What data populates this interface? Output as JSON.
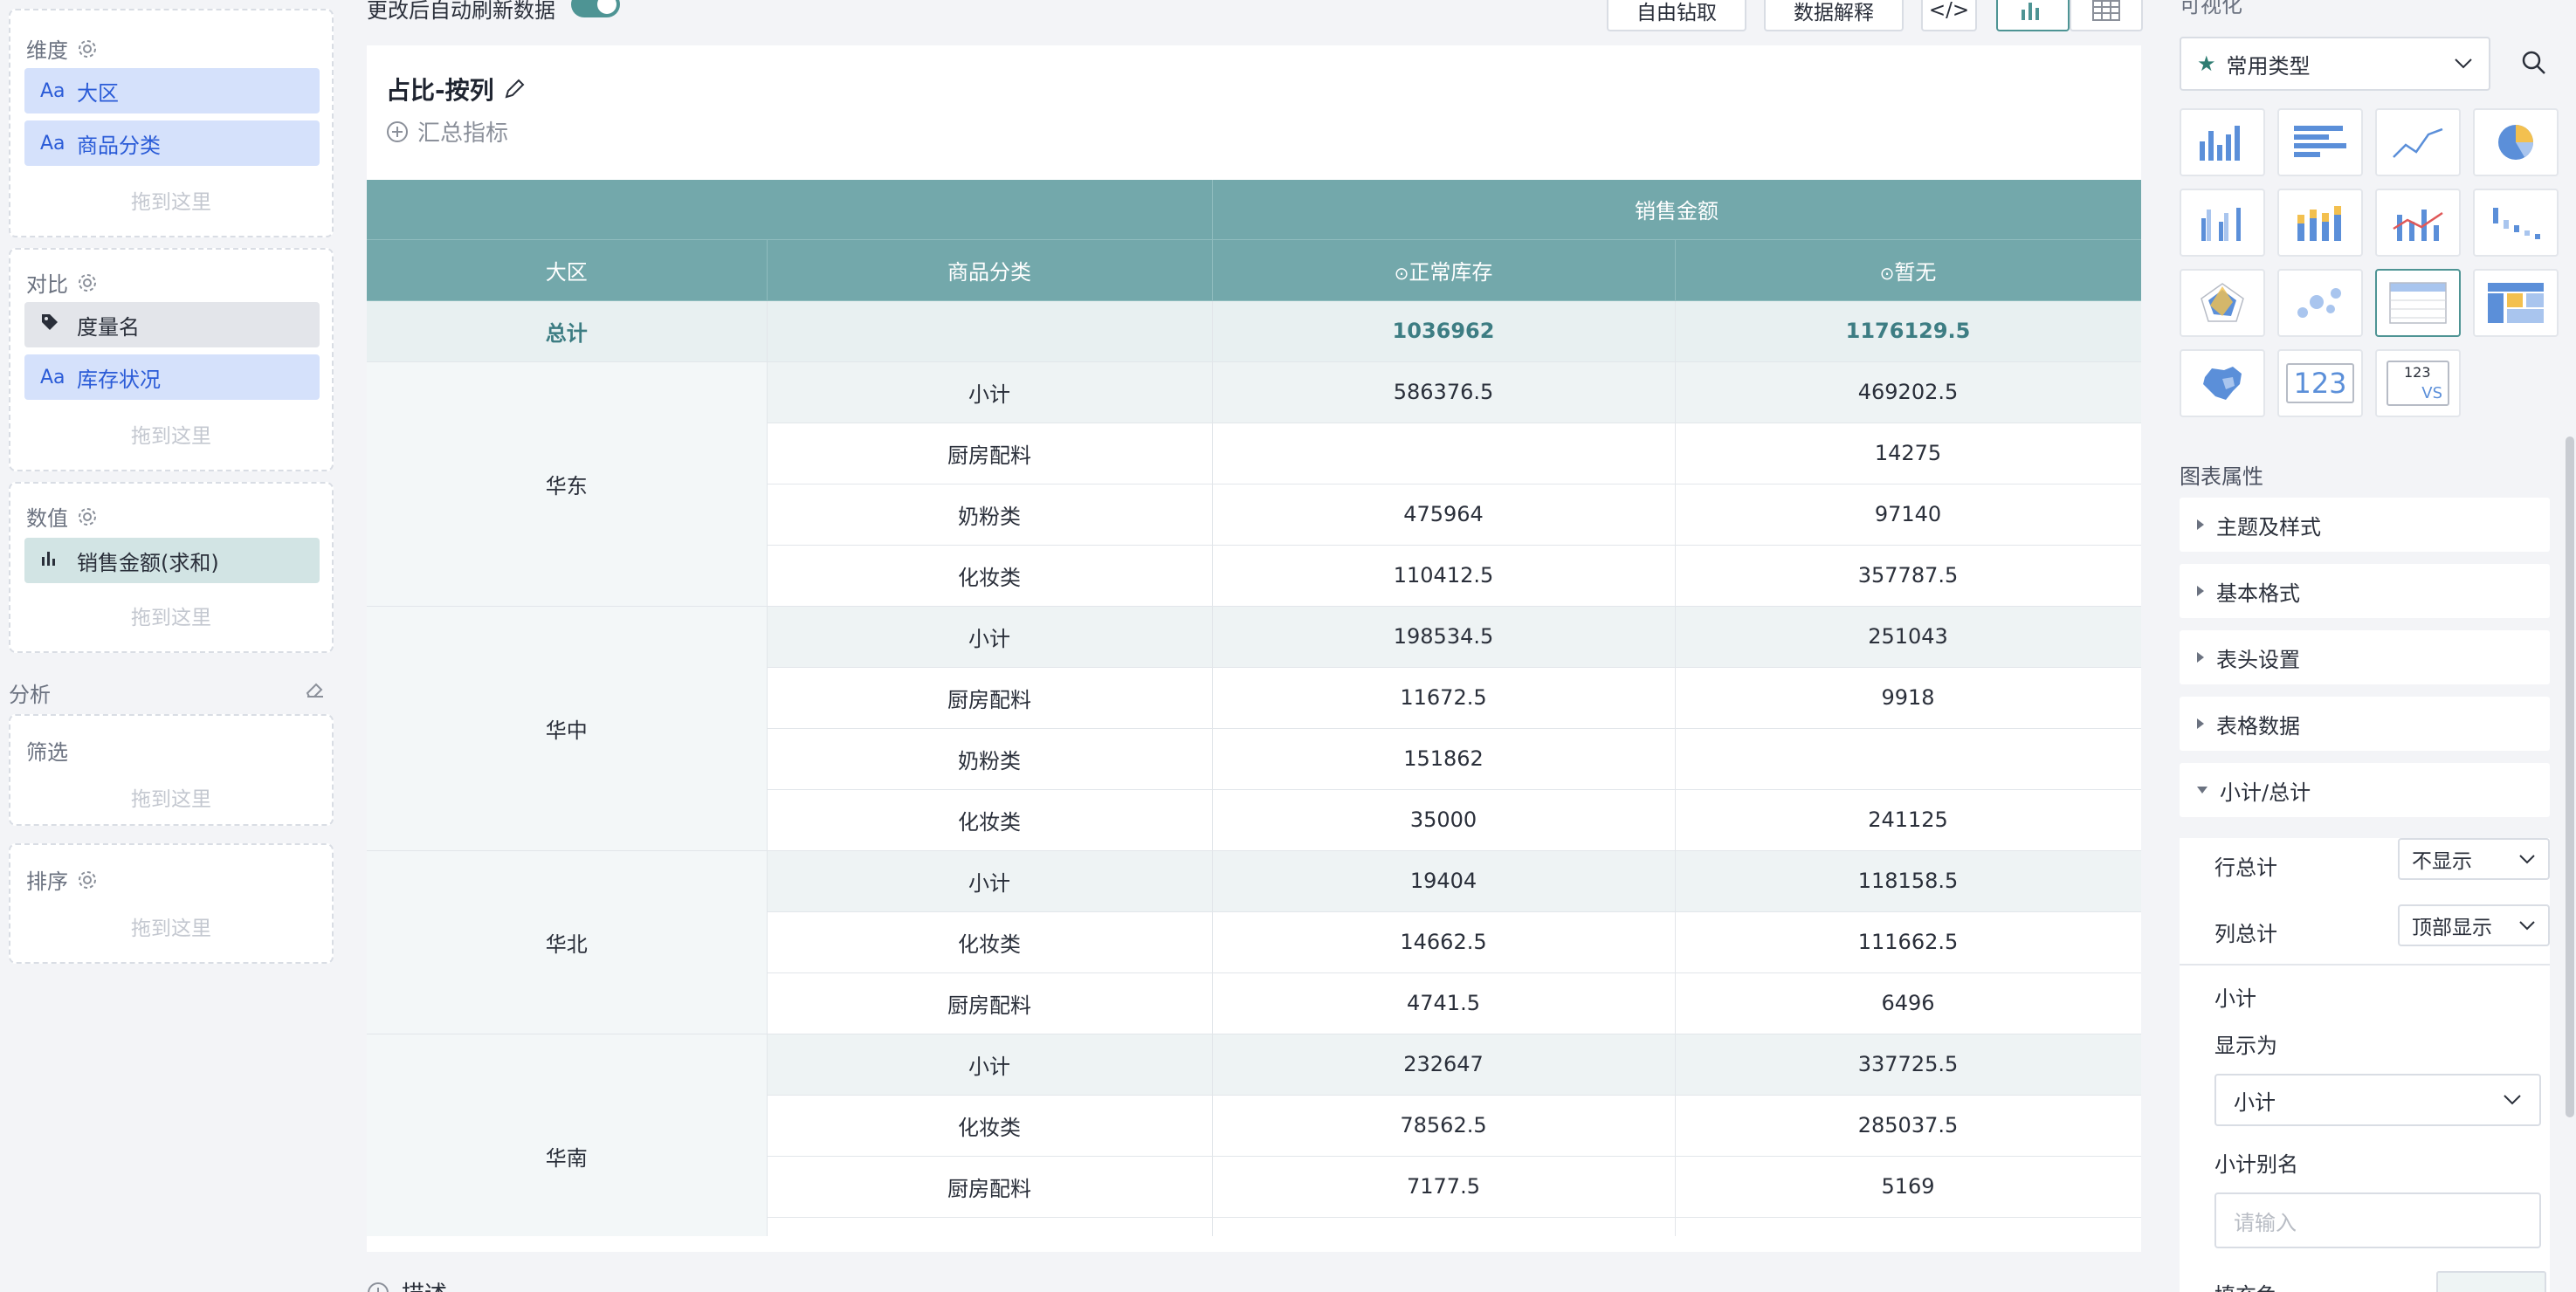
{
  "left_panel": {
    "dimensions": {
      "title": "维度",
      "items": [
        {
          "type": "Aa",
          "label": "大区"
        },
        {
          "type": "Aa",
          "label": "商品分类"
        }
      ],
      "drop_hint": "拖到这里"
    },
    "compare": {
      "title": "对比",
      "items": [
        {
          "type": "tag-icon",
          "label": "度量名"
        },
        {
          "type": "Aa",
          "label": "库存状况"
        }
      ],
      "drop_hint": "拖到这里"
    },
    "values": {
      "title": "数值",
      "items": [
        {
          "type": "bar-chart-icon",
          "label": "销售金额(求和)"
        }
      ],
      "drop_hint": "拖到这里"
    },
    "analysis_label": "分析",
    "filter": {
      "title": "筛选",
      "drop_hint": "拖到这里"
    },
    "sort": {
      "title": "排序",
      "drop_hint": "拖到这里"
    }
  },
  "toolbar": {
    "auto_refresh_label": "更改后自动刷新数据",
    "drill_label": "自由钻取",
    "explain_label": "数据解释",
    "code_label": "</>",
    "colors": {
      "accent": "#4e9494"
    }
  },
  "card": {
    "title": "占比-按列",
    "add_metric": "汇总指标",
    "description_label": "描述"
  },
  "table": {
    "group_header": "销售金额",
    "columns": [
      "大区",
      "商品分类",
      "正常库存",
      "暂无"
    ],
    "total": {
      "label": "总计",
      "normal": "1036962",
      "none": "1176129.5"
    },
    "regions": [
      {
        "name": "华东",
        "rows": [
          {
            "cat": "小计",
            "normal": "586376.5",
            "none": "469202.5",
            "subtotal": true
          },
          {
            "cat": "厨房配料",
            "normal": "",
            "none": "14275"
          },
          {
            "cat": "奶粉类",
            "normal": "475964",
            "none": "97140"
          },
          {
            "cat": "化妆类",
            "normal": "110412.5",
            "none": "357787.5"
          }
        ]
      },
      {
        "name": "华中",
        "rows": [
          {
            "cat": "小计",
            "normal": "198534.5",
            "none": "251043",
            "subtotal": true
          },
          {
            "cat": "厨房配料",
            "normal": "11672.5",
            "none": "9918"
          },
          {
            "cat": "奶粉类",
            "normal": "151862",
            "none": ""
          },
          {
            "cat": "化妆类",
            "normal": "35000",
            "none": "241125"
          }
        ]
      },
      {
        "name": "华北",
        "rows": [
          {
            "cat": "小计",
            "normal": "19404",
            "none": "118158.5",
            "subtotal": true
          },
          {
            "cat": "化妆类",
            "normal": "14662.5",
            "none": "111662.5"
          },
          {
            "cat": "厨房配料",
            "normal": "4741.5",
            "none": "6496"
          }
        ]
      },
      {
        "name": "华南",
        "rows": [
          {
            "cat": "小计",
            "normal": "232647",
            "none": "337725.5",
            "subtotal": true
          },
          {
            "cat": "化妆类",
            "normal": "78562.5",
            "none": "285037.5"
          },
          {
            "cat": "厨房配料",
            "normal": "7177.5",
            "none": "5169"
          },
          {
            "cat": "",
            "normal": "",
            "none": ""
          }
        ]
      }
    ]
  },
  "right_panel": {
    "top_label": "可视化",
    "chart_type_select": "常用类型",
    "number_tile": "123",
    "vs_tile": "123",
    "vs_label": "VS",
    "props_label": "图表属性",
    "accordions": [
      "主题及样式",
      "基本格式",
      "表头设置",
      "表格数据"
    ],
    "expanded_section": "小计/总计",
    "row_total_label": "行总计",
    "row_total_value": "不显示",
    "col_total_label": "列总计",
    "col_total_value": "顶部显示",
    "subtotal_label": "小计",
    "display_as_label": "显示为",
    "display_as_value": "小计",
    "alias_label": "小计别名",
    "alias_placeholder": "请输入",
    "fill_label": "填充色"
  }
}
